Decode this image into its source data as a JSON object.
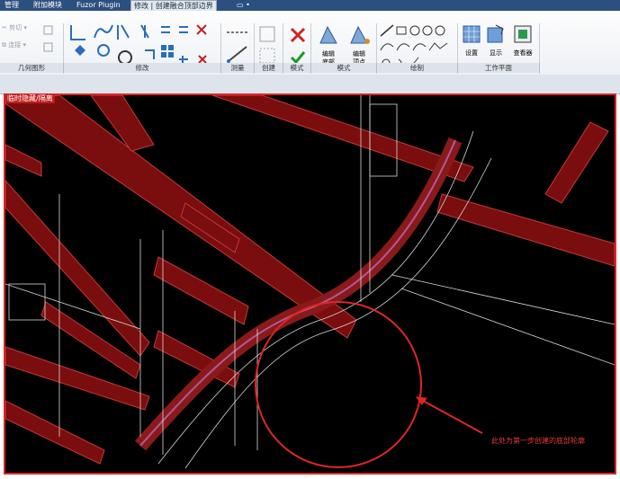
{
  "tabs": [
    {
      "label": "管理"
    },
    {
      "label": "附加模块"
    },
    {
      "label": "Fuzor Plugin"
    },
    {
      "label": "修改 | 创建融合顶部边界"
    },
    {
      "label": "▭ •"
    }
  ],
  "left_tools": [
    {
      "label": "剪切",
      "icon": "scissors-icon"
    },
    {
      "label": "连接",
      "icon": "join-icon"
    }
  ],
  "panels": [
    {
      "label": "几何图形"
    },
    {
      "label": "修改"
    },
    {
      "label": "测量"
    },
    {
      "label": "创建"
    },
    {
      "label": "模式"
    },
    {
      "label": "模式"
    },
    {
      "label": "绘制"
    },
    {
      "label": "工作平面"
    }
  ],
  "buttons": {
    "edit_base": "编辑\n底部",
    "edit_vertex": "编辑\n顶点",
    "settings": "设置",
    "show": "显示",
    "viewer": "查看器"
  },
  "viewport_label": "临时隐藏/隔离",
  "annotation_note": "此处为第一步创建的底部轮廓",
  "colors": {
    "accent": "#e02525",
    "beam": "#8a1010",
    "ribbon_tab": "#2b4f7f"
  }
}
